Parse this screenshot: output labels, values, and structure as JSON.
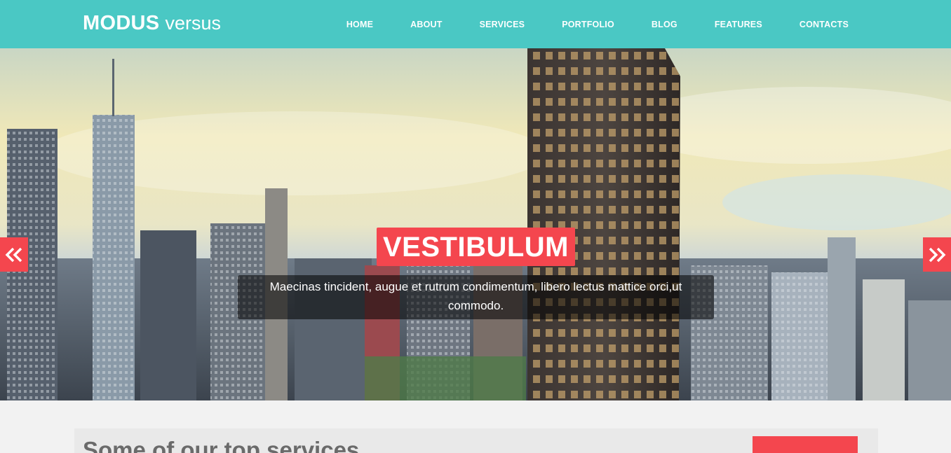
{
  "brand": {
    "name_bold": "MODUS",
    "name_light": "versus"
  },
  "nav": {
    "items": [
      {
        "label": "HOME"
      },
      {
        "label": "ABOUT"
      },
      {
        "label": "SERVICES"
      },
      {
        "label": "PORTFOLIO"
      },
      {
        "label": "BLOG"
      },
      {
        "label": "FEATURES"
      },
      {
        "label": "CONTACTS"
      }
    ]
  },
  "slider": {
    "title": "VESTIBULUM",
    "caption": "Maecinas tincident, augue et rutrum condimentum, libero lectus mattice orci,ut commodo.",
    "prev_icon": "double-chevron-left-icon",
    "next_icon": "double-chevron-right-icon"
  },
  "services": {
    "title": "Some of our top services"
  },
  "colors": {
    "header": "#4ac8c4",
    "accent": "#f4464e",
    "page_background": "#f2f2f2"
  }
}
